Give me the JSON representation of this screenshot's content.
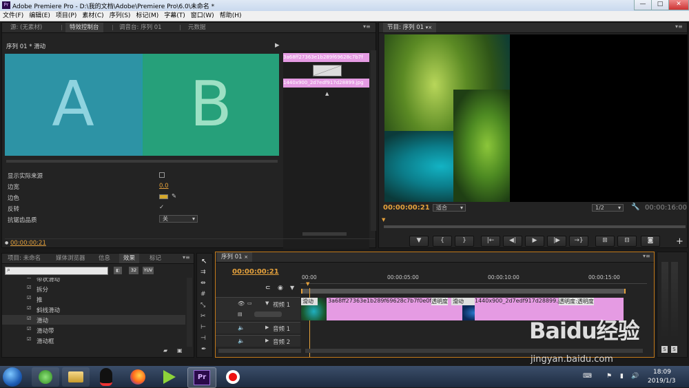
{
  "window": {
    "title": "Adobe Premiere Pro - D:\\我的文档\\Adobe\\Premiere Pro\\6.0\\未命名 *",
    "min": "—",
    "max": "□",
    "close": "✕"
  },
  "menu": [
    "文件(F)",
    "编辑(E)",
    "项目(P)",
    "素材(C)",
    "序列(S)",
    "标记(M)",
    "字幕(T)",
    "窗口(W)",
    "帮助(H)"
  ],
  "source_panel": {
    "tabs": [
      "源: (无素材)",
      "特效控制台",
      "调音台: 序列 01",
      "元数据"
    ],
    "header": "序列 01 * 滑动",
    "preview_a": "A",
    "preview_b": "B",
    "clip_a": "3a68ff27363e1b289f69628c7b7f",
    "clip_b": "1440x900_2d7edf917d28899.jpg",
    "properties": [
      {
        "label": "显示实际来源",
        "value": ""
      },
      {
        "label": "边宽",
        "value": "0.0"
      },
      {
        "label": "边色",
        "value": ""
      },
      {
        "label": "反转",
        "value": "✓"
      },
      {
        "label": "抗锯齿品质",
        "value": "关"
      }
    ],
    "timecode": "00:00:00:21"
  },
  "program": {
    "tab": "节目: 序列 01",
    "timecode": "00:00:00:21",
    "fit": "适合",
    "quality": "1/2",
    "duration": "00:00:16:00",
    "controls": [
      "▼",
      "{",
      "}",
      "|←",
      "◀|",
      "▶",
      "|▶",
      "→}",
      "⊞",
      "⊟",
      "◙"
    ]
  },
  "project": {
    "tabs": [
      "项目: 未命名",
      "媒体浏览器",
      "信息",
      "效果",
      "标记"
    ],
    "tiles": [
      "32",
      "YUV"
    ],
    "items": [
      "带状滑动",
      "拆分",
      "推",
      "斜线滑动",
      "滑动",
      "滑动带",
      "滑动框"
    ]
  },
  "timeline": {
    "tab": "序列 01",
    "timecode": "00:00:00:21",
    "ruler": [
      "00:00",
      "00:00:05:00",
      "00:00:10:00",
      "00:00:15:00"
    ],
    "video_track": "视频 1",
    "audio_tracks": [
      "音频 1",
      "音频 2"
    ],
    "transition": "滑动",
    "clip1": "3a68ff27363e1b289f69628c7b7f0e0f.jpg",
    "clip1_opacity": "透明度",
    "clip2": "1440x900_2d7edf917d28899.jpg",
    "clip2_opacity": "透明度:透明度",
    "meter_labels": [
      "S",
      "S"
    ]
  },
  "taskbar": {
    "time": "18:09",
    "date": "2019/1/3"
  },
  "watermark": {
    "brand": "Baidu经验",
    "url": "jingyan.baidu.com"
  }
}
